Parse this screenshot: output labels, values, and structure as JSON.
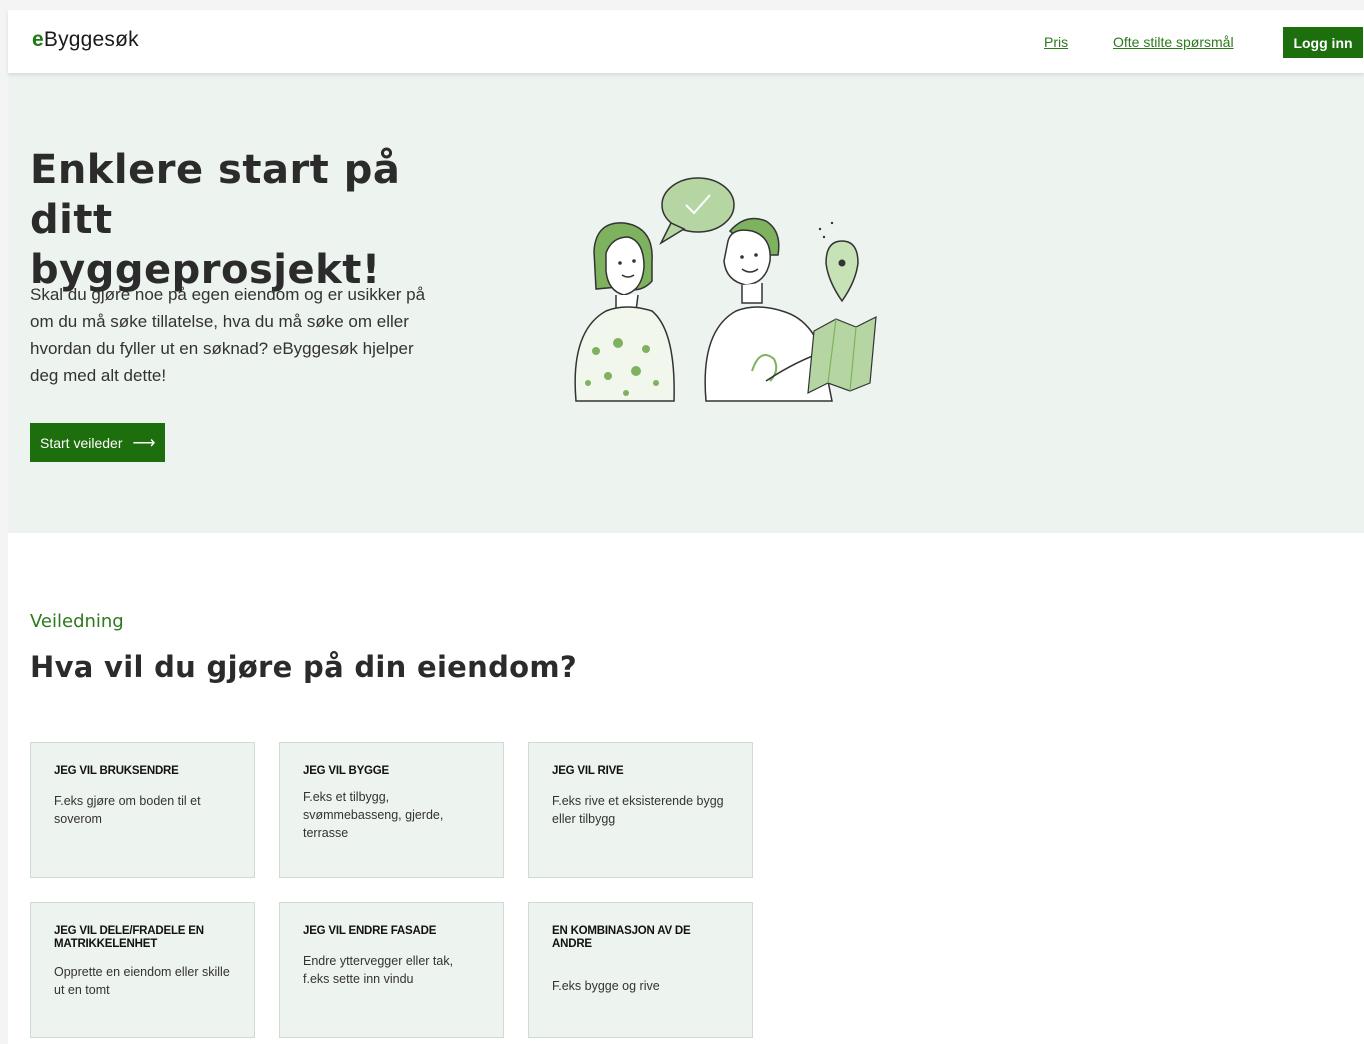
{
  "header": {
    "logo_e": "e",
    "logo_rest": "Byggesøk",
    "nav": [
      {
        "label": "Pris"
      },
      {
        "label": "Ofte stilte spørsmål"
      }
    ],
    "login_label": "Logg inn"
  },
  "hero": {
    "title_line1": "Enklere start på ditt",
    "title_line2": "byggeprosjekt!",
    "description": "Skal du gjøre noe på egen eiendom og er usikker på om du må søke tillatelse, hva du må søke om eller hvordan du fyller ut en søknad? eByggesøk hjelper deg med alt dette!",
    "cta_label": "Start veileder",
    "cta_arrow": "⟶"
  },
  "guidance": {
    "eyebrow": "Veiledning",
    "title": "Hva vil du gjøre på din eiendom?",
    "cards": [
      {
        "title": "JEG VIL BRUKSENDRE",
        "description": "F.eks gjøre om boden til et soverom"
      },
      {
        "title": "JEG VIL BYGGE",
        "description": "F.eks et tilbygg, svømmebasseng, gjerde, terrasse"
      },
      {
        "title": "JEG VIL RIVE",
        "description": "F.eks rive et eksisterende bygg eller tilbygg"
      },
      {
        "title": "JEG VIL DELE/FRADELE EN MATRIKKELENHET",
        "description": "Opprette en eiendom eller skille ut en tomt"
      },
      {
        "title": "JEG VIL ENDRE FASADE",
        "description": "Endre yttervegger eller tak, f.eks sette inn vindu"
      },
      {
        "title": "EN KOMBINASJON AV DE ANDRE",
        "description": "F.eks bygge og rive"
      }
    ]
  },
  "colors": {
    "brand_green": "#1d6e0c",
    "link_green": "#2d7a1e",
    "hero_bg": "#edf3ee"
  }
}
